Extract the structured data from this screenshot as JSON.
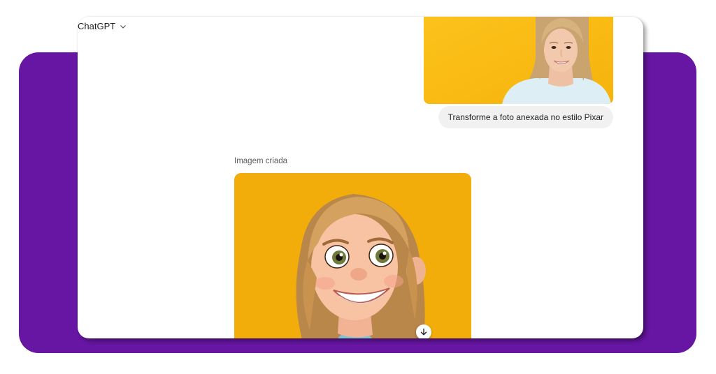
{
  "header": {
    "model_label": "ChatGPT",
    "model_dropdown_icon": "chevron-down-icon"
  },
  "conversation": {
    "user_message": "Transforme a foto anexada no estilo Pixar",
    "attachment_icon": "photo-of-woman",
    "assistant": {
      "label": "Imagem criada",
      "image_icon": "pixar-style-portrait",
      "download_icon": "download-icon"
    }
  },
  "colors": {
    "backdrop": "#6616a2",
    "photo_bg": "#fbbd13",
    "generated_bg": "#f2ad0b",
    "bubble_bg": "#f1f1f1"
  }
}
